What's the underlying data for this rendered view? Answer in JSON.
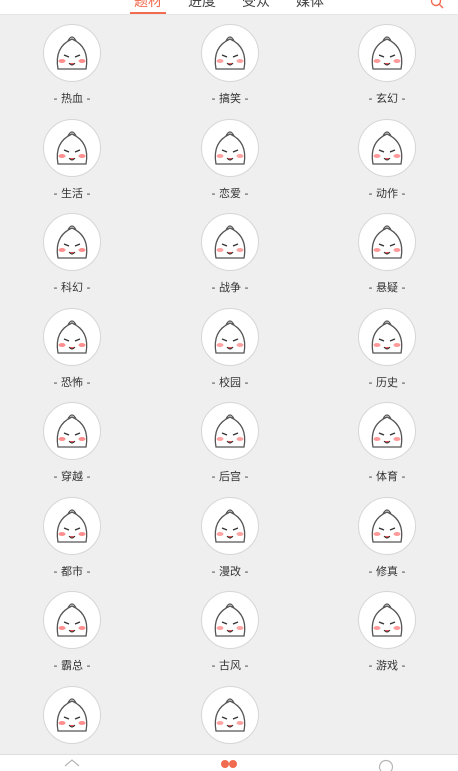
{
  "tabs": [
    {
      "label": "题材",
      "active": true
    },
    {
      "label": "进度",
      "active": false
    },
    {
      "label": "受众",
      "active": false
    },
    {
      "label": "媒体",
      "active": false
    }
  ],
  "accent_color": "#f06b4f",
  "genres": [
    {
      "label": "- 热血 -",
      "icon": "hot-blood-icon"
    },
    {
      "label": "- 搞笑 -",
      "icon": "funny-icon"
    },
    {
      "label": "- 玄幻 -",
      "icon": "fantasy-icon"
    },
    {
      "label": "- 生活 -",
      "icon": "life-icon"
    },
    {
      "label": "- 恋爱 -",
      "icon": "romance-icon"
    },
    {
      "label": "- 动作 -",
      "icon": "action-icon"
    },
    {
      "label": "- 科幻 -",
      "icon": "sci-fi-icon"
    },
    {
      "label": "- 战争 -",
      "icon": "war-icon"
    },
    {
      "label": "- 悬疑 -",
      "icon": "suspense-icon"
    },
    {
      "label": "- 恐怖 -",
      "icon": "horror-icon"
    },
    {
      "label": "- 校园 -",
      "icon": "campus-icon"
    },
    {
      "label": "- 历史 -",
      "icon": "history-icon"
    },
    {
      "label": "- 穿越 -",
      "icon": "time-travel-icon"
    },
    {
      "label": "- 后宫 -",
      "icon": "harem-icon"
    },
    {
      "label": "- 体育 -",
      "icon": "sports-icon"
    },
    {
      "label": "- 都市 -",
      "icon": "urban-icon"
    },
    {
      "label": "- 漫改 -",
      "icon": "manga-adaptation-icon"
    },
    {
      "label": "- 修真 -",
      "icon": "cultivation-icon"
    },
    {
      "label": "- 霸总 -",
      "icon": "ceo-icon"
    },
    {
      "label": "- 古风 -",
      "icon": "ancient-style-icon"
    },
    {
      "label": "- 游戏 -",
      "icon": "game-icon"
    },
    {
      "label": "",
      "icon": "extra-genre-icon-1"
    },
    {
      "label": "",
      "icon": "extra-genre-icon-2"
    }
  ],
  "bottom_nav": [
    {
      "icon": "home-icon",
      "active": false
    },
    {
      "icon": "category-icon",
      "active": true
    },
    {
      "icon": "profile-icon",
      "active": false
    }
  ]
}
